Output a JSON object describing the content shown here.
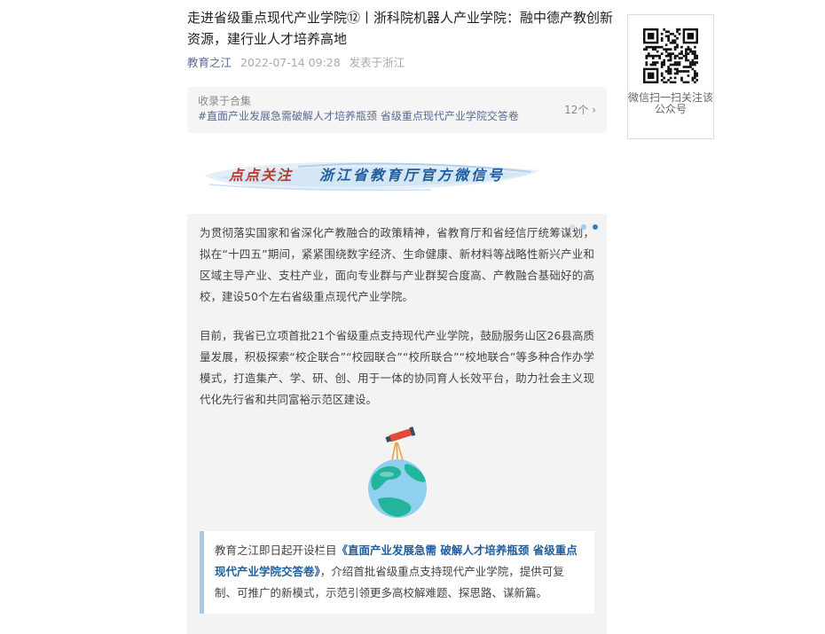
{
  "article": {
    "title": "走进省级重点现代产业学院⑫丨浙科院机器人产业学院：融中德产教创新资源，建行业人才培养高地",
    "author": "教育之江",
    "date": "2022-07-14 09:28",
    "location": "发表于浙江"
  },
  "collection": {
    "label": "收录于合集",
    "tags": "#直面产业发展急需破解人才培养瓶颈 省级重点现代产业学院交答卷",
    "count": "12个"
  },
  "banner": {
    "left_text": "点点关注",
    "right_text": "浙江省教育厅官方微信号"
  },
  "content": {
    "paragraph1": "为贯彻落实国家和省深化产教融合的政策精神，省教育厅和省经信厅统筹谋划，拟在“十四五”期间，紧紧围绕数字经济、生命健康、新材料等战略性新兴产业和区域主导产业、支柱产业，面向专业群与产业群契合度高、产教融合基础好的高校，建设50个左右省级重点现代产业学院。",
    "paragraph2": "目前，我省已立项首批21个省级重点支持现代产业学院，鼓励服务山区26县高质量发展，积极探索“校企联合”“校园联合”“校所联合”“校地联合”等多种合作办学模式，打造集产、学、研、创、用于一体的协同育人长效平台，助力社会主义现代化先行省和共同富裕示范区建设。",
    "quote_before": "教育之江即日起开设栏目",
    "quote_highlight": "《直面产业发展急需 破解人才培养瓶颈 省级重点现代产业学院交答卷》",
    "quote_after": "，介绍首批省级重点支持现代产业学院，提供可复制、可推广的新模式，示范引领更多高校解难题、探思路、谋新篇。"
  },
  "qr": {
    "caption": "微信扫一扫关注该公众号"
  },
  "colors": {
    "link": "#576b95",
    "highlight": "#1f5e9e",
    "quote_border": "#a9c7ea"
  }
}
